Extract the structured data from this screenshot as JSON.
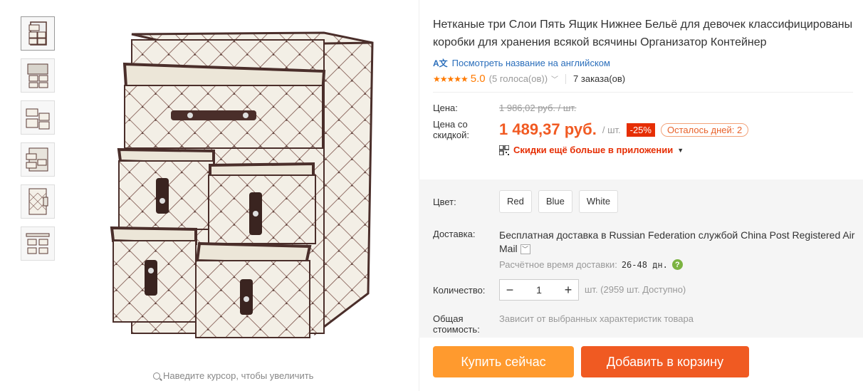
{
  "product": {
    "title": "Нетканые три Слои Пять Ящик Нижнее Бельё для девочек классифицированы коробки для хранения всякой всячины Организатор Контейнер",
    "translate_link": "Посмотреть название на английском",
    "rating_score": "5.0",
    "votes": "(5 голоса(ов))",
    "orders": "7 заказа(ов)",
    "zoom_hint": "Наведите курсор, чтобы увеличить"
  },
  "price": {
    "label_price": "Цена:",
    "old_price": "1 986,02 руб. / шт.",
    "label_discount": "Цена со скидкой:",
    "new_price": "1 489,37 руб.",
    "unit": "/ шт.",
    "discount_badge": "-25%",
    "days_left": "Осталось дней: 2",
    "app_promo": "Скидки ещё больше в приложении"
  },
  "options": {
    "color_label": "Цвет:",
    "colors": [
      "Red",
      "Blue",
      "White"
    ],
    "delivery_label": "Доставка:",
    "delivery_free": "Бесплатная доставка в",
    "delivery_country": "Russian Federation",
    "delivery_service_prefix": "службой",
    "delivery_service": "China Post Registered Air Mail",
    "eta_label": "Расчётное время доставки:",
    "eta_days": "26-48 дн.",
    "qty_label": "Количество:",
    "qty_value": "1",
    "qty_note": "шт. (2959 шт. Доступно)",
    "total_label": "Общая стоимость:",
    "total_note": "Зависит от выбранных характеристик товара"
  },
  "actions": {
    "buy_now": "Купить сейчас",
    "add_to_cart": "Добавить в корзину"
  },
  "colors_theme": {
    "price": "#f15a22",
    "buy_now": "#ff9a2e",
    "add_cart": "#f05a22",
    "link": "#2a6ebb"
  }
}
